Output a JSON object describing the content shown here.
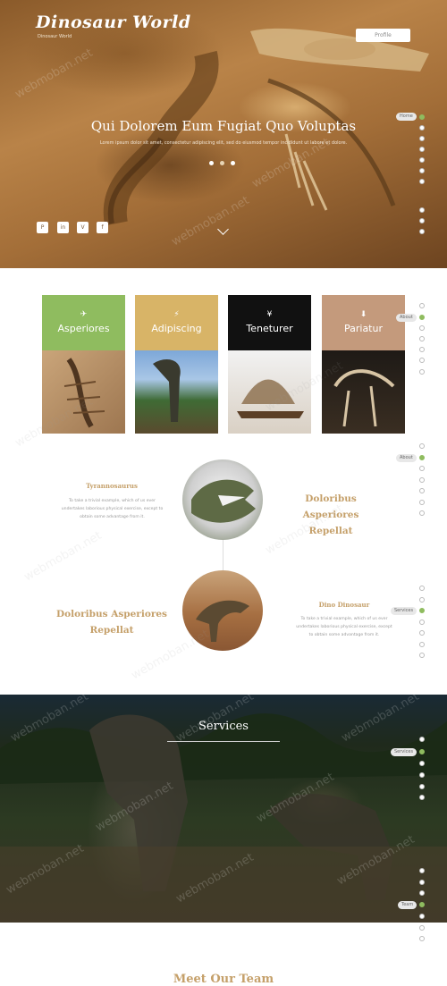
{
  "header": {
    "brand": "Dinosaur World",
    "tagline": "Dinosaur World",
    "profile_button": "Profile"
  },
  "hero": {
    "title": "Qui Dolorem Eum Fugiat Quo Voluptas",
    "subtitle": "Lorem ipsum dolor sit amet, consectetur adipiscing elit, sed do eiusmod tempor incididunt ut labore et dolore.",
    "slides": 3,
    "active_slide": 1,
    "social_icons": [
      "pinterest-icon",
      "linkedin-icon",
      "vimeo-icon",
      "facebook-icon"
    ],
    "social_glyphs": [
      "P",
      "in",
      "V",
      "f"
    ]
  },
  "side_nav": {
    "home_label": "Home",
    "about_label": "About",
    "services_label": "Services",
    "team_label": "Team"
  },
  "cards": [
    {
      "title": "Asperiores",
      "icon": "paper-plane-icon",
      "glyph": "✈",
      "color": "#8fbc5f"
    },
    {
      "title": "Adipiscing",
      "icon": "bolt-icon",
      "glyph": "⚡",
      "color": "#d8b467"
    },
    {
      "title": "Teneturer",
      "icon": "yen-icon",
      "glyph": "¥",
      "color": "#111111"
    },
    {
      "title": "Pariatur",
      "icon": "download-icon",
      "glyph": "⬇",
      "color": "#c49a7c"
    }
  ],
  "timeline": {
    "item1_heading": "Tyrannosaurus",
    "item1_text": "To take a trivial example, which of us ever undertakes laborious physical exercise, except to obtain some advantage from it.",
    "item1_right_l1": "Doloribus Asperiores",
    "item1_right_l2": "Repellat",
    "item2_left_l1": "Doloribus Asperiores",
    "item2_left_l2": "Repellat",
    "item2_heading": "Dino Dinosaur",
    "item2_text": "To take a trivial example, which of us ever undertakes laborious physical exercise, except to obtain some advantage from it."
  },
  "services": {
    "title": "Services"
  },
  "team": {
    "title": "Meet Our Team"
  },
  "watermark": "webmoban.net",
  "colors": {
    "accent_green": "#8fbc5f",
    "accent_gold": "#c5a06a"
  }
}
